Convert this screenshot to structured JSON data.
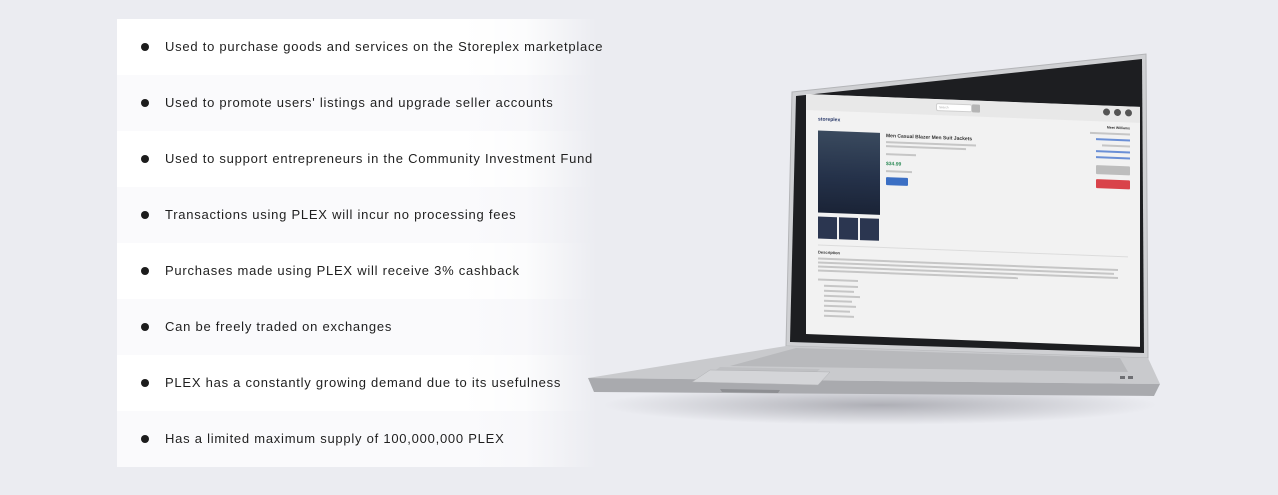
{
  "features": [
    {
      "text": "Used to purchase goods and services on the Storeplex marketplace"
    },
    {
      "text": "Used to promote users' listings and upgrade seller accounts"
    },
    {
      "text": "Used to support entrepreneurs in the Community Investment Fund"
    },
    {
      "text": "Transactions using PLEX will incur no processing fees"
    },
    {
      "text": "Purchases made using PLEX will receive 3% cashback"
    },
    {
      "text": "Can be freely traded on exchanges"
    },
    {
      "text": "PLEX has a constantly growing demand due to its usefulness"
    },
    {
      "text": "Has a limited maximum supply of 100,000,000 PLEX"
    }
  ],
  "screen": {
    "logo": "storeplex",
    "search_placeholder": "Search",
    "product_title": "Men Casual Blazer Men Suit Jackets",
    "price": "$34.99",
    "seller_panel_title": "Meet Williams",
    "description_heading": "Description"
  },
  "colors": {
    "background": "#ebecf1",
    "bullet": "#1c1c1c",
    "text": "#1f1f1f"
  }
}
